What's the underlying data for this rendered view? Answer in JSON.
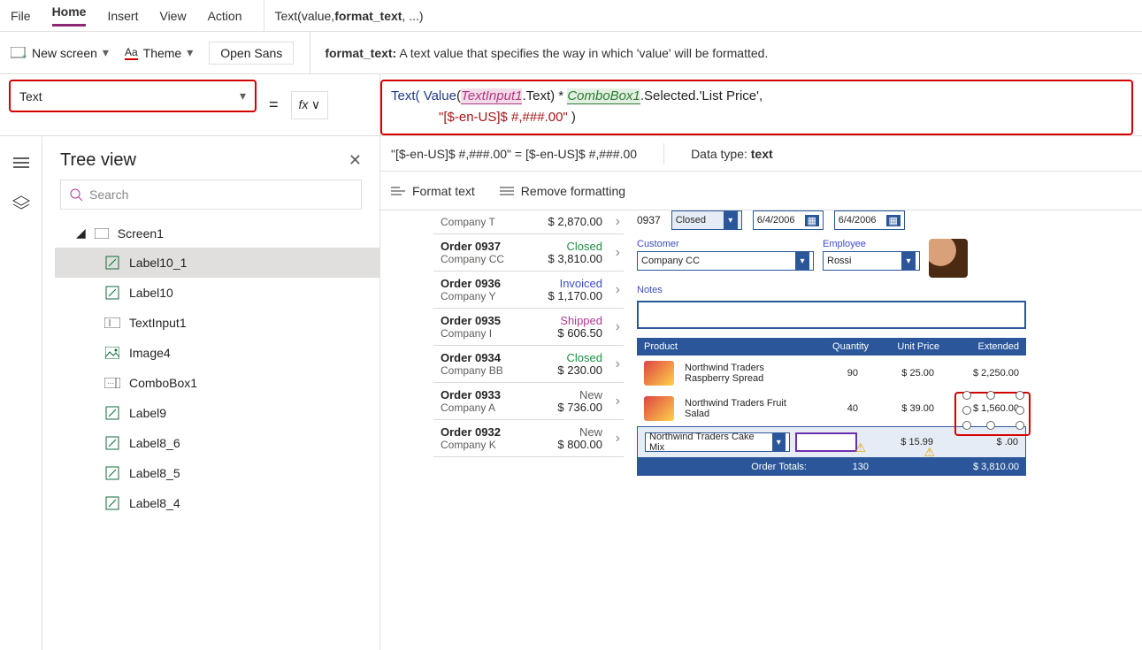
{
  "menu": {
    "file": "File",
    "home": "Home",
    "insert": "Insert",
    "view": "View",
    "action": "Action"
  },
  "signature": {
    "prefix": "Text(value, ",
    "bold": "format_text",
    "suffix": ", ...)"
  },
  "ribbon": {
    "newscreen": "New screen",
    "theme": "Theme",
    "font": "Open Sans"
  },
  "help": {
    "label": "format_text:",
    "text": " A text value that specifies the way in which 'value' will be formatted."
  },
  "property": {
    "name": "Text"
  },
  "eq": "=",
  "fx": "fx",
  "formula": {
    "p1": "Text( ",
    "p2": "Value",
    "p3": "(",
    "ref1": "TextInput1",
    "p4": ".Text) * ",
    "ref2": "ComboBox1",
    "p5": ".Selected.'List Price',",
    "str": "\"[$-en-US]$ #,###.00\"",
    "p6": " )"
  },
  "result": {
    "left": "\"[$-en-US]$ #,###.00\"  =  [$-en-US]$ #,###.00",
    "rightlabel": "Data type: ",
    "type": "text"
  },
  "tools": {
    "format": "Format text",
    "remove": "Remove formatting"
  },
  "tree": {
    "title": "Tree view",
    "search_placeholder": "Search",
    "root": "Screen1",
    "items": [
      {
        "icon": "pencil",
        "label": "Label10_1",
        "selected": true
      },
      {
        "icon": "pencil",
        "label": "Label10"
      },
      {
        "icon": "textinput",
        "label": "TextInput1"
      },
      {
        "icon": "image",
        "label": "Image4"
      },
      {
        "icon": "combo",
        "label": "ComboBox1"
      },
      {
        "icon": "pencil",
        "label": "Label9"
      },
      {
        "icon": "pencil",
        "label": "Label8_6"
      },
      {
        "icon": "pencil",
        "label": "Label8_5"
      },
      {
        "icon": "pencil",
        "label": "Label8_4"
      }
    ]
  },
  "orders": [
    {
      "title": "",
      "company": "Company T",
      "status": "",
      "statusClass": "",
      "amount": "$ 2,870.00"
    },
    {
      "title": "Order 0937",
      "company": "Company CC",
      "status": "Closed",
      "statusClass": "closed",
      "amount": "$ 3,810.00"
    },
    {
      "title": "Order 0936",
      "company": "Company Y",
      "status": "Invoiced",
      "statusClass": "invoiced",
      "amount": "$ 1,170.00"
    },
    {
      "title": "Order 0935",
      "company": "Company I",
      "status": "Shipped",
      "statusClass": "shipped",
      "amount": "$ 606.50"
    },
    {
      "title": "Order 0934",
      "company": "Company BB",
      "status": "Closed",
      "statusClass": "closed",
      "amount": "$ 230.00"
    },
    {
      "title": "Order 0933",
      "company": "Company A",
      "status": "New",
      "statusClass": "new",
      "amount": "$ 736.00"
    },
    {
      "title": "Order 0932",
      "company": "Company K",
      "status": "New",
      "statusClass": "new",
      "amount": "$ 800.00"
    }
  ],
  "detail": {
    "orderno": "0937",
    "status": "Closed",
    "date1": "6/4/2006",
    "date2": "6/4/2006",
    "customer_label": "Customer",
    "customer": "Company CC",
    "employee_label": "Employee",
    "employee": "Rossi",
    "notes_label": "Notes",
    "header": {
      "product": "Product",
      "qty": "Quantity",
      "price": "Unit Price",
      "ext": "Extended"
    },
    "rows": [
      {
        "name": "Northwind Traders Raspberry Spread",
        "qty": "90",
        "price": "$ 25.00",
        "ext": "$ 2,250.00"
      },
      {
        "name": "Northwind Traders Fruit Salad",
        "qty": "40",
        "price": "$ 39.00",
        "ext": "$ 1,560.00"
      }
    ],
    "input": {
      "name": "Northwind Traders Cake Mix",
      "price": "$ 15.99",
      "ext": "$ .00"
    },
    "totals": {
      "label": "Order Totals:",
      "qty": "130",
      "amount": "$ 3,810.00"
    }
  }
}
